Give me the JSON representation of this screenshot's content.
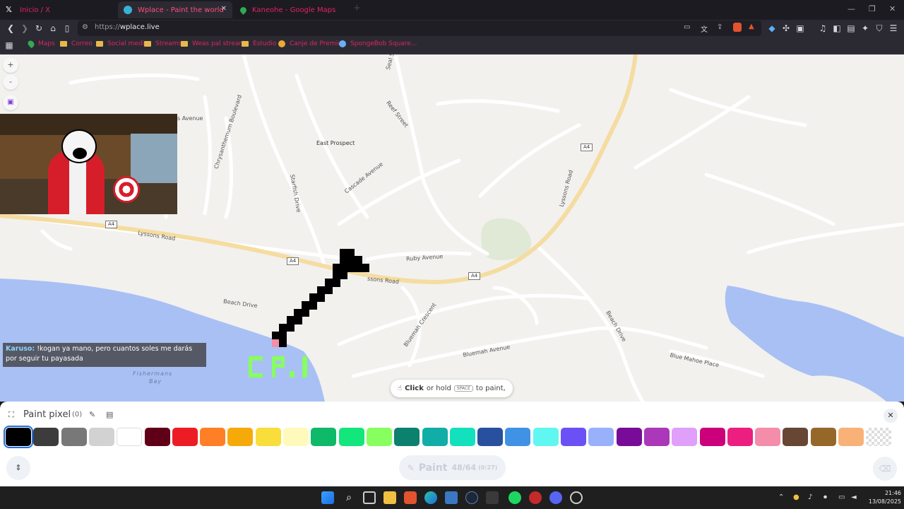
{
  "browser": {
    "tabs": [
      {
        "label": "Inicio / X",
        "active": false
      },
      {
        "label": "Wplace - Paint the world",
        "active": true
      },
      {
        "label": "Kaneohe - Google Maps",
        "active": false
      }
    ],
    "url_protocol": "https://",
    "url_host": "wplace.live",
    "bookmarks": [
      "Maps",
      "Correo",
      "Social media",
      "Streams",
      "Weas pal stream",
      "Estudio",
      "Canje de Premios",
      "SpongeBob Square..."
    ],
    "accent_color": "#e0245e"
  },
  "map": {
    "labels": {
      "east_prospect": "East Prospect",
      "reef_street": "Reef Street",
      "cascade_avenue": "Cascade Avenue",
      "starfish_drive": "Starfish Drive",
      "chrysanthemum": "Chrysanthemum Boulevard",
      "avenue_cut": "s Avenue",
      "lyssons_road_left": "Lyssons Road",
      "lyssons_road_right": "Lyssons Road",
      "lyssons_road_mid": "ssons Road",
      "ruby_avenue": "Ruby Avenue",
      "beach_drive_left": "Beach Drive",
      "beach_drive_right": "Beach Drive",
      "bluemah_crescent": "Bluemah Crescent",
      "bluemah_avenue": "Bluemah Avenue",
      "blue_mahoe_place": "Blue Mahoe Place",
      "fishermans": "Fishermans",
      "bay": "Bay",
      "seal_cut": "Seal S"
    },
    "shields": [
      "A4",
      "A4",
      "A4",
      "A4"
    ],
    "zoom_in": "+",
    "zoom_out": "-"
  },
  "chat": {
    "user": "Karuso:",
    "message": "!kogan ya mano, pero cuantos soles me darás por seguir tu payasada"
  },
  "hint": {
    "bold": "Click",
    "middle": "or hold",
    "key": "SPACE",
    "end": "to paint,"
  },
  "panel": {
    "title": "Paint pixel",
    "count": "(0)",
    "palette": [
      "#000000",
      "#3c3c3c",
      "#787878",
      "#d2d2d2",
      "#ffffff",
      "#600018",
      "#ed1c24",
      "#ff7f27",
      "#f6aa09",
      "#f9dd3b",
      "#fffabc",
      "#0eb968",
      "#13e67b",
      "#87ff5e",
      "#0c816e",
      "#10aea6",
      "#13e1be",
      "#28509e",
      "#4093e4",
      "#60f7f2",
      "#6b50f6",
      "#99b1fb",
      "#780c99",
      "#aa38b9",
      "#e09ff9",
      "#cb007a",
      "#ec1f80",
      "#f38da9",
      "#684634",
      "#95682a",
      "#f8b277",
      "transparent"
    ],
    "paint_label": "Paint",
    "paint_count": "48/64",
    "paint_timer": "(0:27)"
  },
  "taskbar": {
    "time": "21:46",
    "date": "13/08/2025"
  }
}
